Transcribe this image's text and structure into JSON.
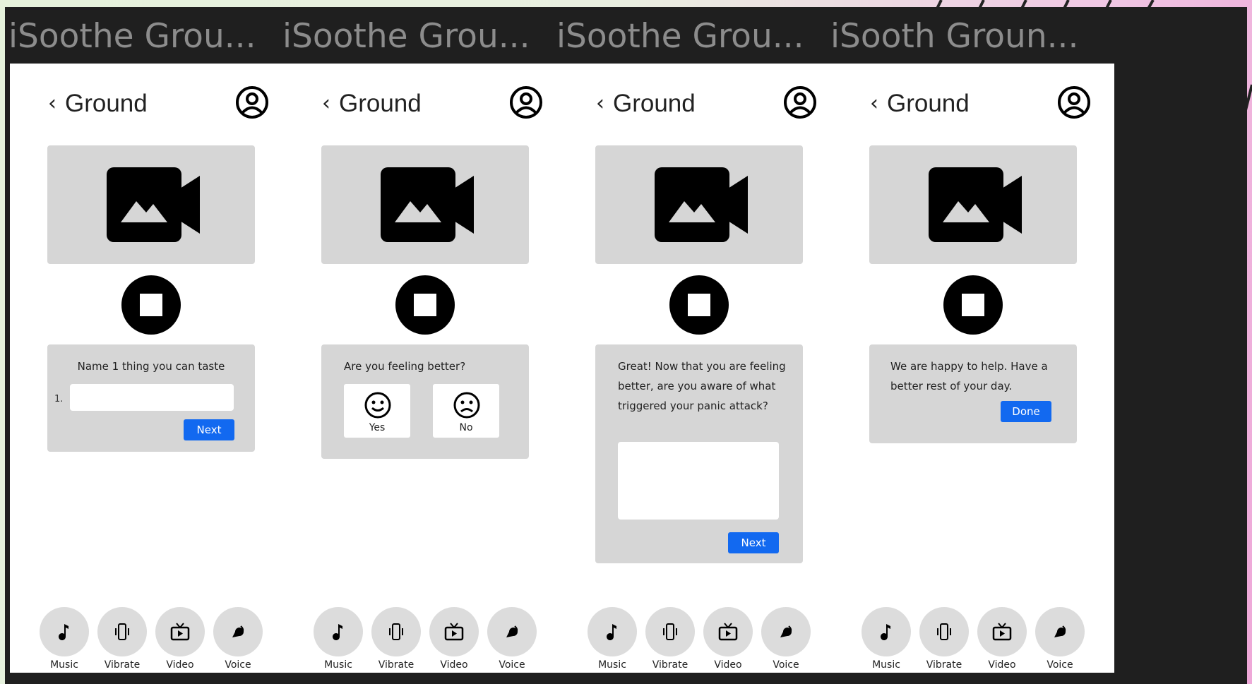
{
  "accent_color": "#1269f0",
  "frames": [
    {
      "title": "iSoothe Grou...",
      "header": {
        "back_icon": "chevron-left-icon",
        "title": "Ground",
        "profile_icon": "user-circle-icon"
      },
      "media_icon": "video-image-icon",
      "stop_icon": "stop-icon",
      "prompt": "Name 1 thing you can taste",
      "field_index": "1.",
      "button": "Next"
    },
    {
      "title": "iSoothe Grou...",
      "header": {
        "back_icon": "chevron-left-icon",
        "title": "Ground",
        "profile_icon": "user-circle-icon"
      },
      "media_icon": "video-image-icon",
      "stop_icon": "stop-icon",
      "prompt": "Are you feeling better?",
      "options": [
        {
          "label": "Yes",
          "icon": "smile-icon"
        },
        {
          "label": "No",
          "icon": "frown-icon"
        }
      ]
    },
    {
      "title": "iSoothe Grou...",
      "header": {
        "back_icon": "chevron-left-icon",
        "title": "Ground",
        "profile_icon": "user-circle-icon"
      },
      "media_icon": "video-image-icon",
      "stop_icon": "stop-icon",
      "prompt": "Great! Now that you are feeling better, are you aware of what triggered your panic attack?",
      "button": "Next"
    },
    {
      "title": "iSooth Groun...",
      "header": {
        "back_icon": "chevron-left-icon",
        "title": "Ground",
        "profile_icon": "user-circle-icon"
      },
      "media_icon": "video-image-icon",
      "stop_icon": "stop-icon",
      "prompt": "We are happy to help. Have a better rest of your day.",
      "button": "Done"
    }
  ],
  "bottom_nav": [
    {
      "label": "Music",
      "icon": "music-note-icon"
    },
    {
      "label": "Vibrate",
      "icon": "vibrate-icon"
    },
    {
      "label": "Video",
      "icon": "tv-play-icon"
    },
    {
      "label": "Voice",
      "icon": "voice-icon"
    }
  ]
}
